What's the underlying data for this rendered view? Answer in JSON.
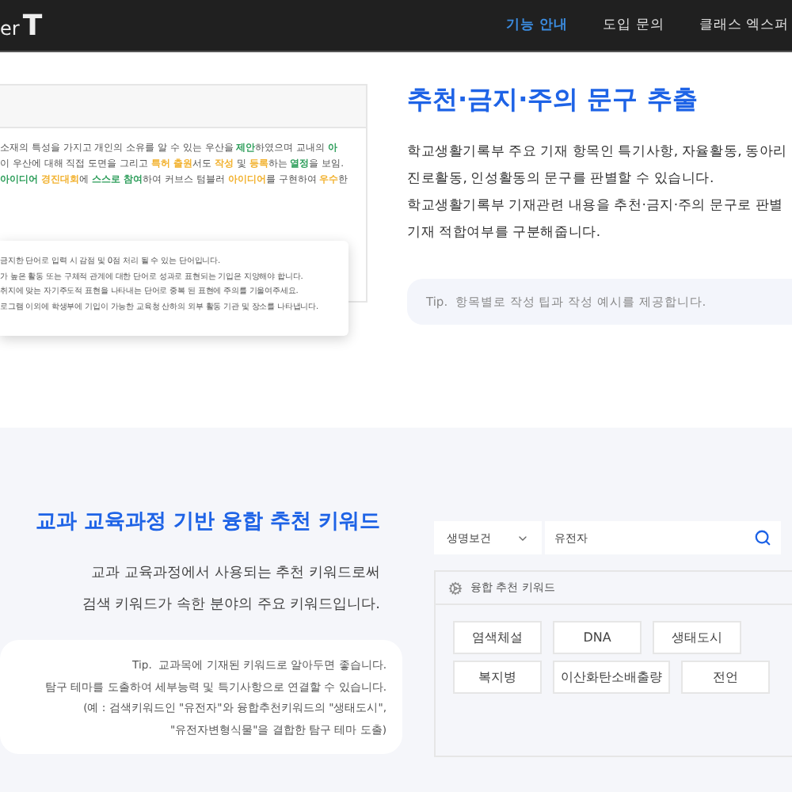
{
  "header": {
    "logo": {
      "text": "er",
      "mark": "T"
    },
    "nav": [
      {
        "label": "기능 안내",
        "selected": true
      },
      {
        "label": "도입 문의",
        "selected": false
      },
      {
        "label": "클래스 엑스퍼",
        "selected": false
      }
    ]
  },
  "example_card": {
    "lines": [
      [
        {
          "text": "소재의 특성을 가지고 개인의 소유를 알 수 있는 우산을 "
        },
        {
          "text": "제안",
          "color": "#2e9e5b"
        },
        {
          "text": "하였으며 교내의 "
        },
        {
          "text": "아",
          "color": "#2e9e5b"
        }
      ],
      [
        {
          "text": " 이 우산에 대해 직접 도면을 그리고 "
        },
        {
          "text": "특허 출원",
          "color": "#f2b230"
        },
        {
          "text": "서도 "
        },
        {
          "text": "작성",
          "color": "#f2b230"
        },
        {
          "text": " 및 "
        },
        {
          "text": "등록",
          "color": "#f2b230"
        },
        {
          "text": "하는 "
        },
        {
          "text": "열정",
          "color": "#2e9e5b"
        },
        {
          "text": "을 보임."
        }
      ],
      [
        {
          "text": "아이디어",
          "color": "#2e9e5b"
        },
        {
          "text": " 경진대회",
          "color": "#f2b230"
        },
        {
          "text": "에 "
        },
        {
          "text": "스스로 참여",
          "color": "#2e9e5b"
        },
        {
          "text": "하여 커브스 텀블러 "
        },
        {
          "text": "아이디어",
          "color": "#f2b230"
        },
        {
          "text": "를 구현하여 "
        },
        {
          "text": "우수",
          "color": "#f2b230"
        },
        {
          "text": "한"
        }
      ]
    ],
    "popup": [
      "금지한 단어로 입력 시 감점 및 0점 처리 될 수 있는 단어입니다.",
      "가 높은 활동 또는 구체적 관계에 대한 단어로 성과로 표현되는 기입은 지양해야 합니다.",
      "취지에 맞는 자기주도적 표현을 나타내는 단어로 중복 된 표현에 주의를 기울여주세요.",
      "로그램 이외에 학생부에 기입이 가능한 교육청 산하의 외부 활동 기관 및 장소를 나타냅니다."
    ]
  },
  "feature": {
    "title": "추천·금지·주의 문구 추출",
    "paragraph": [
      "학교생활기록부 주요 기재 항목인 특기사항, 자율활동, 동아리",
      "진로활동, 인성활동의 문구를 판별할 수 있습니다.",
      "학교생활기록부 기재관련 내용을 추천·금지·주의 문구로 판별",
      "기재 적합여부를 구분해줍니다."
    ],
    "tip": {
      "label": "Tip.",
      "text": "항목별로 작성 팁과 작성 예시를 제공합니다."
    }
  },
  "keywords": {
    "title": "교과 교육과정 기반 융합 추천 키워드",
    "description": [
      "교과 교육과정에서 사용되는 추천 키워드로써",
      "검색 키워드가 속한 분야의 주요 키워드입니다."
    ],
    "tip": {
      "label": "Tip.",
      "lines": [
        "교과목에 기재된 키워드로 알아두면 좋습니다.",
        "탐구 테마를 도출하여 세부능력 및 특기사항으로 연결할 수 있습니다.",
        "(예 : 검색키워드인 \"유전자\"와 융합추천키워드의 \"생태도시\",",
        "\"유전자변형식물\"을 결합한 탐구 테마 도출)"
      ]
    },
    "filter": {
      "category": "생명보건",
      "query": "유전자"
    },
    "panel": {
      "title": "융합 추천 키워드",
      "chip_rows": [
        [
          "염색체설",
          "DNA",
          "생태도시"
        ],
        [
          "복지병",
          "이산화탄소배출량",
          "전언"
        ]
      ]
    }
  }
}
